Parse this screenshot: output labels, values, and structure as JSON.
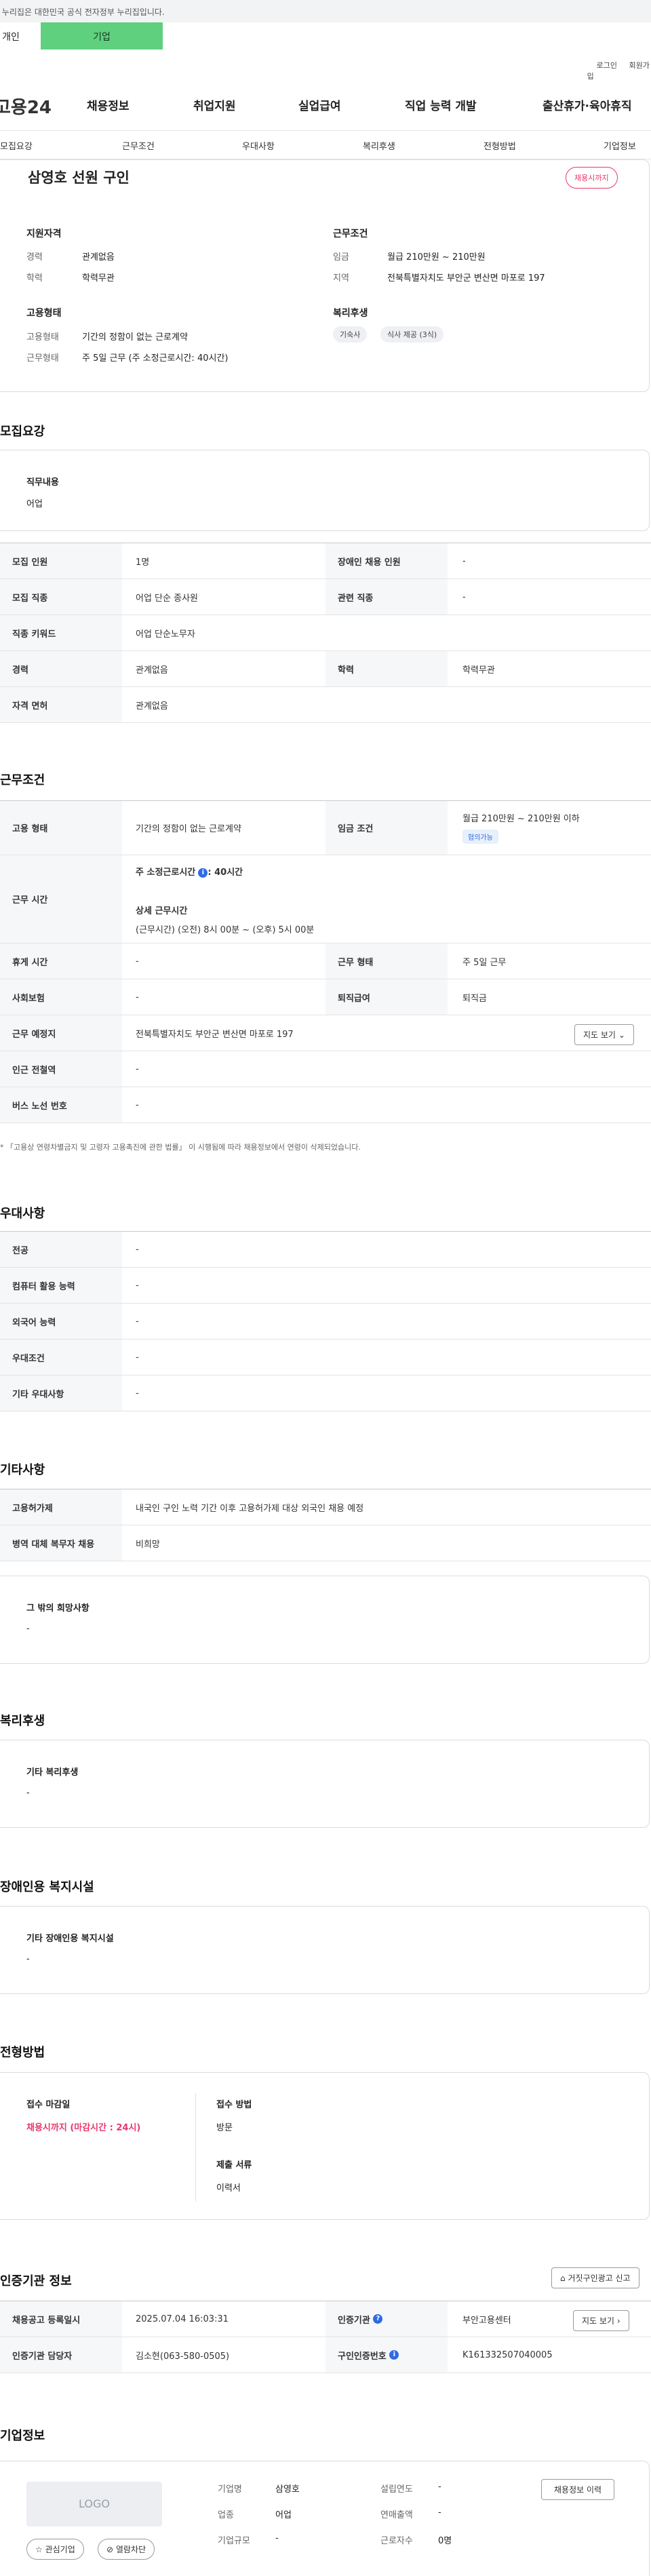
{
  "gov_banner": "이 누리집은 대한민국 공식 전자정부 누리집입니다.",
  "user_tabs": {
    "individual": "개인",
    "corporate": "기업"
  },
  "top_links": [
    "로그인",
    "회원가입"
  ],
  "logo": "고용24",
  "gnb": [
    "채용정보",
    "취업지원",
    "실업급여",
    "직업 능력 개발",
    "출산휴가·육아휴직"
  ],
  "sub_tabs": [
    "모집요강",
    "근무조건",
    "우대사항",
    "복리후생",
    "전형방법",
    "기업정보"
  ],
  "job": {
    "title": "삼영호 선원 구인",
    "deadline_badge": "채용시까지",
    "qual_heading": "지원자격",
    "career_label": "경력",
    "career_value": "관계없음",
    "edu_label": "학력",
    "edu_value": "학력무관",
    "emp_heading": "고용형태",
    "emp_type_label": "고용형태",
    "emp_type_value": "기간의 정함이 없는 근로계약",
    "work_type_label": "근무형태",
    "work_type_value": "주 5일 근무 (주 소정근로시간: 40시간)",
    "cond_heading": "근무조건",
    "wage_label": "임금",
    "wage_value": "월급 210만원 ~ 210만원",
    "region_label": "지역",
    "region_value": "전북특별자치도 부안군 변산면 마포로 197",
    "welfare_heading": "복리후생",
    "welfare_chips": [
      "기숙사",
      "식사 제공 (3식)"
    ]
  },
  "recruit": {
    "title": "모집요강",
    "duty_label": "직무내용",
    "duty_value": "어업",
    "rows": [
      {
        "h1": "모집 인원",
        "v1": "1명",
        "h2": "장애인 채용 인원",
        "v2": "-"
      },
      {
        "h1": "모집 직종",
        "v1": "어업 단순 종사원",
        "h2": "관련 직종",
        "v2": "-"
      },
      {
        "h1": "직종 키워드",
        "v1": "어업 단순노무자"
      },
      {
        "h1": "경력",
        "v1": "관계없음",
        "h2": "학력",
        "v2": "학력무관"
      },
      {
        "h1": "자격 면허",
        "v1": "관계없음"
      }
    ]
  },
  "work": {
    "title": "근무조건",
    "emp_h": "고용 형태",
    "emp_v": "기간의 정함이 없는 근로계약",
    "wage_h": "임금 조건",
    "wage_v": "월급 210만원 ~ 210만원 이하",
    "wage_badge": "협의가능",
    "hours_h": "근무 시간",
    "hours_main": "주 소정근로시간",
    "hours_main_val": ": 40시간",
    "hours_detail_h": "상세 근무시간",
    "hours_detail_v": "(근무시간) (오전) 8시 00분 ~ (오후) 5시 00분",
    "rest_h": "휴게 시간",
    "rest_v": "-",
    "form_h": "근무 형태",
    "form_v": "주 5일 근무",
    "ins_h": "사회보험",
    "ins_v": "-",
    "sev_h": "퇴직급여",
    "sev_v": "퇴직금",
    "place_h": "근무 예정지",
    "place_v": "전북특별자치도 부안군 변산면 마포로 197",
    "map_btn": "지도 보기",
    "station_h": "인근 전철역",
    "station_v": "-",
    "bus_h": "버스 노선 번호",
    "bus_v": "-",
    "note": "* 「고용상 연령차별금지 및 고령자 고용촉진에 관한 법률」 이 시행됨에 따라 채용정보에서 연령이 삭제되었습니다."
  },
  "pref": {
    "title": "우대사항",
    "rows": [
      {
        "h": "전공",
        "v": "-"
      },
      {
        "h": "컴퓨터 활용 능력",
        "v": "-"
      },
      {
        "h": "외국어 능력",
        "v": "-"
      },
      {
        "h": "우대조건",
        "v": "-"
      },
      {
        "h": "기타 우대사항",
        "v": "-"
      }
    ]
  },
  "etc": {
    "title": "기타사항",
    "rows": [
      {
        "h": "고용허가제",
        "v": "내국인 구인 노력 기간 이후 고용허가제 대상 외국인 채용 예정"
      },
      {
        "h": "병역 대체 복무자 채용",
        "v": "비희망"
      }
    ],
    "other_label": "그 밖의 희망사항",
    "other_value": "-"
  },
  "welfare": {
    "title": "복리후생",
    "label": "기타 복리후생",
    "value": "-"
  },
  "disabled": {
    "title": "장애인용 복지시설",
    "label": "기타 장애인용 복지시설",
    "value": "-"
  },
  "selection": {
    "title": "전형방법",
    "deadline_label": "접수 마감일",
    "deadline_value": "채용시까지 (마감시간 : 24시)",
    "method_label": "접수 방법",
    "method_value": "방문",
    "docs_label": "제출 서류",
    "docs_value": "이력서"
  },
  "cert": {
    "title": "인증기관 정보",
    "report_btn": "거짓구인광고 신고",
    "reg_h": "채용공고 등록일시",
    "reg_v": "2025.07.04 16:03:31",
    "org_h": "인증기관",
    "org_v": "부안고용센터",
    "map_btn": "지도 보기",
    "mgr_h": "인증기관 담당자",
    "mgr_v": "김소현(063-580-0505)",
    "no_h": "구인인증번호",
    "no_v": "K161332507040005"
  },
  "company": {
    "title": "기업정보",
    "logo_text": "LOGO",
    "interest_btn": "관심기업",
    "view_btn": "열람차단",
    "name_l": "기업명",
    "name_v": "삼영호",
    "ind_l": "업종",
    "ind_v": "어업",
    "size_l": "기업규모",
    "size_v": "-",
    "est_l": "설립연도",
    "est_v": "-",
    "sales_l": "연매출액",
    "sales_v": "-",
    "emp_l": "근로자수",
    "emp_v": "0명",
    "history_btn": "채용정보 이력"
  },
  "colors": {
    "accent_green": "#5fd07e",
    "deadline_red": "#e8386b",
    "info_blue": "#2f6be3"
  }
}
